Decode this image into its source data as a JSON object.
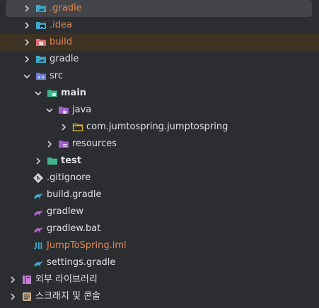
{
  "tree": {
    "rows": [
      {
        "label": ".gradle",
        "icon": "folder-gradle-icon",
        "chevron": "right",
        "depth": 0
      },
      {
        "label": ".idea",
        "icon": "folder-idea-icon",
        "chevron": "right",
        "depth": 0
      },
      {
        "label": "build",
        "icon": "folder-excluded-icon",
        "chevron": "right",
        "depth": 0
      },
      {
        "label": "gradle",
        "icon": "folder-gradle-icon",
        "chevron": "right",
        "depth": 0
      },
      {
        "label": "src",
        "icon": "folder-source-icon",
        "chevron": "down",
        "depth": 0
      },
      {
        "label": "main",
        "icon": "folder-module-icon",
        "chevron": "down",
        "depth": 1
      },
      {
        "label": "java",
        "icon": "folder-java-icon",
        "chevron": "down",
        "depth": 2
      },
      {
        "label": "com.jumtospring.jumptospring",
        "icon": "package-folder-icon",
        "chevron": "right",
        "depth": 3
      },
      {
        "label": "resources",
        "icon": "folder-resources-icon",
        "chevron": "right",
        "depth": 2
      },
      {
        "label": "test",
        "icon": "folder-test-icon",
        "chevron": "right",
        "depth": 1
      },
      {
        "label": ".gitignore",
        "icon": "gitignore-icon",
        "chevron": "none",
        "depth": 1
      },
      {
        "label": "build.gradle",
        "icon": "gradle-file-icon",
        "chevron": "none",
        "depth": 1
      },
      {
        "label": "gradlew",
        "icon": "gradlew-file-icon",
        "chevron": "none",
        "depth": 1
      },
      {
        "label": "gradlew.bat",
        "icon": "gradlew-file-icon",
        "chevron": "none",
        "depth": 1
      },
      {
        "label": "JumpToSpring.iml",
        "icon": "iml-file-icon",
        "chevron": "none",
        "depth": 1
      },
      {
        "label": "settings.gradle",
        "icon": "gradle-file-icon",
        "chevron": "none",
        "depth": 1
      },
      {
        "label": "외부 라이브러리",
        "icon": "external-libraries-icon",
        "chevron": "right",
        "depth": 0
      },
      {
        "label": "스크래치 및 콘솔",
        "icon": "scratches-icon",
        "chevron": "right",
        "depth": 0
      }
    ]
  },
  "colors": {
    "background": "#2b2d30",
    "selected_row": "#43454a",
    "excluded_row": "#3d3223",
    "ignored_text": "#e08855",
    "module_folder": "#3fb28a",
    "source_folder": "#6b7fd7",
    "gradle_icon": "#3fa7c8",
    "gradlew_icon": "#b462c9"
  }
}
